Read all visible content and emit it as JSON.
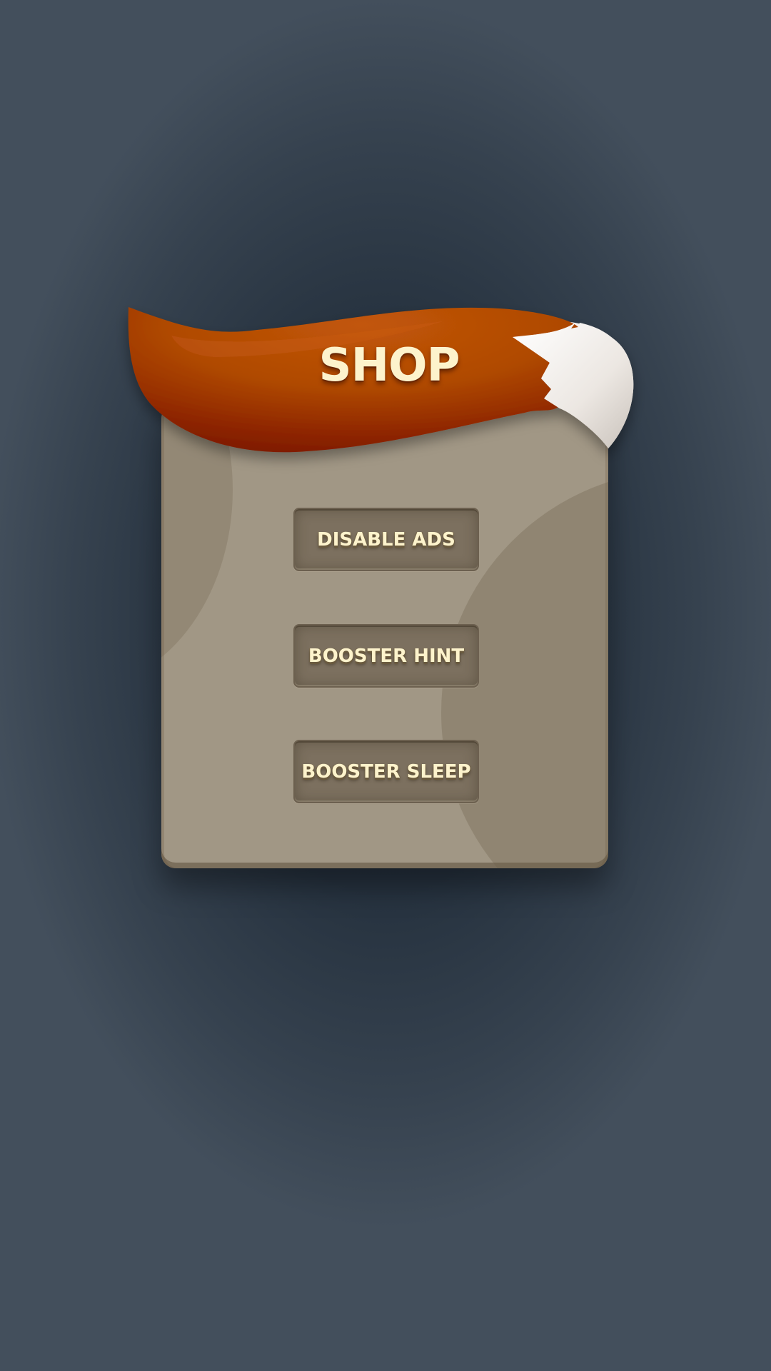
{
  "shop": {
    "title": "SHOP",
    "buttons": [
      {
        "label": "DISABLE ADS"
      },
      {
        "label": "BOOSTER HINT"
      },
      {
        "label": "BOOSTER SLEEP"
      }
    ]
  },
  "colors": {
    "background": "#26323f",
    "panel": "#a19785",
    "button": "#7c705f",
    "tail_orange": "#b84f05",
    "tail_dark": "#7e1a00",
    "tail_tip": "#f2eeea",
    "text": "#fdf3cc"
  },
  "icons": {
    "banner": "fox-tail-banner"
  }
}
